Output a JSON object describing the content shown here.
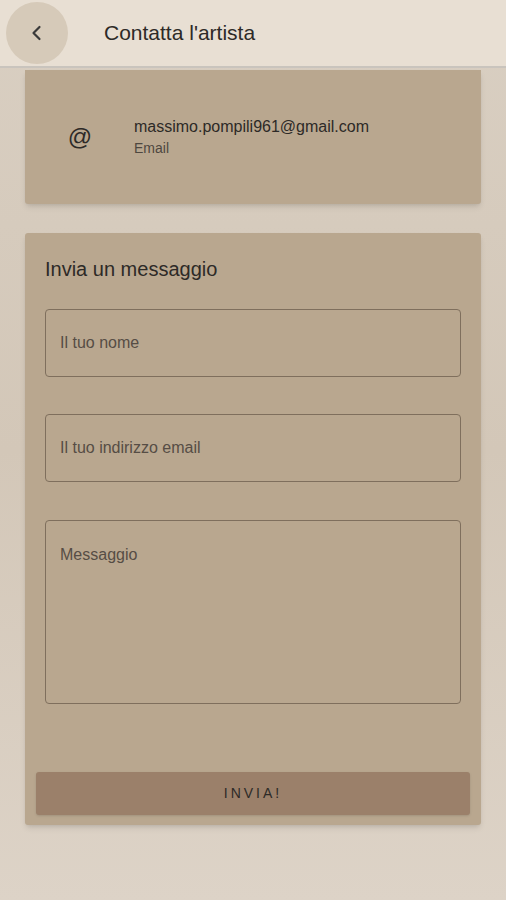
{
  "header": {
    "title": "Contatta l'artista"
  },
  "contact": {
    "icon": "@",
    "value": "massimo.pompili961@gmail.com",
    "label": "Email"
  },
  "form": {
    "title": "Invia un messaggio",
    "fields": [
      {
        "placeholder": "Il tuo nome",
        "kind": "input"
      },
      {
        "placeholder": "Il tuo indirizzo email",
        "kind": "input"
      },
      {
        "placeholder": "Messaggio",
        "kind": "textarea"
      }
    ],
    "submit": "INVIA!"
  }
}
